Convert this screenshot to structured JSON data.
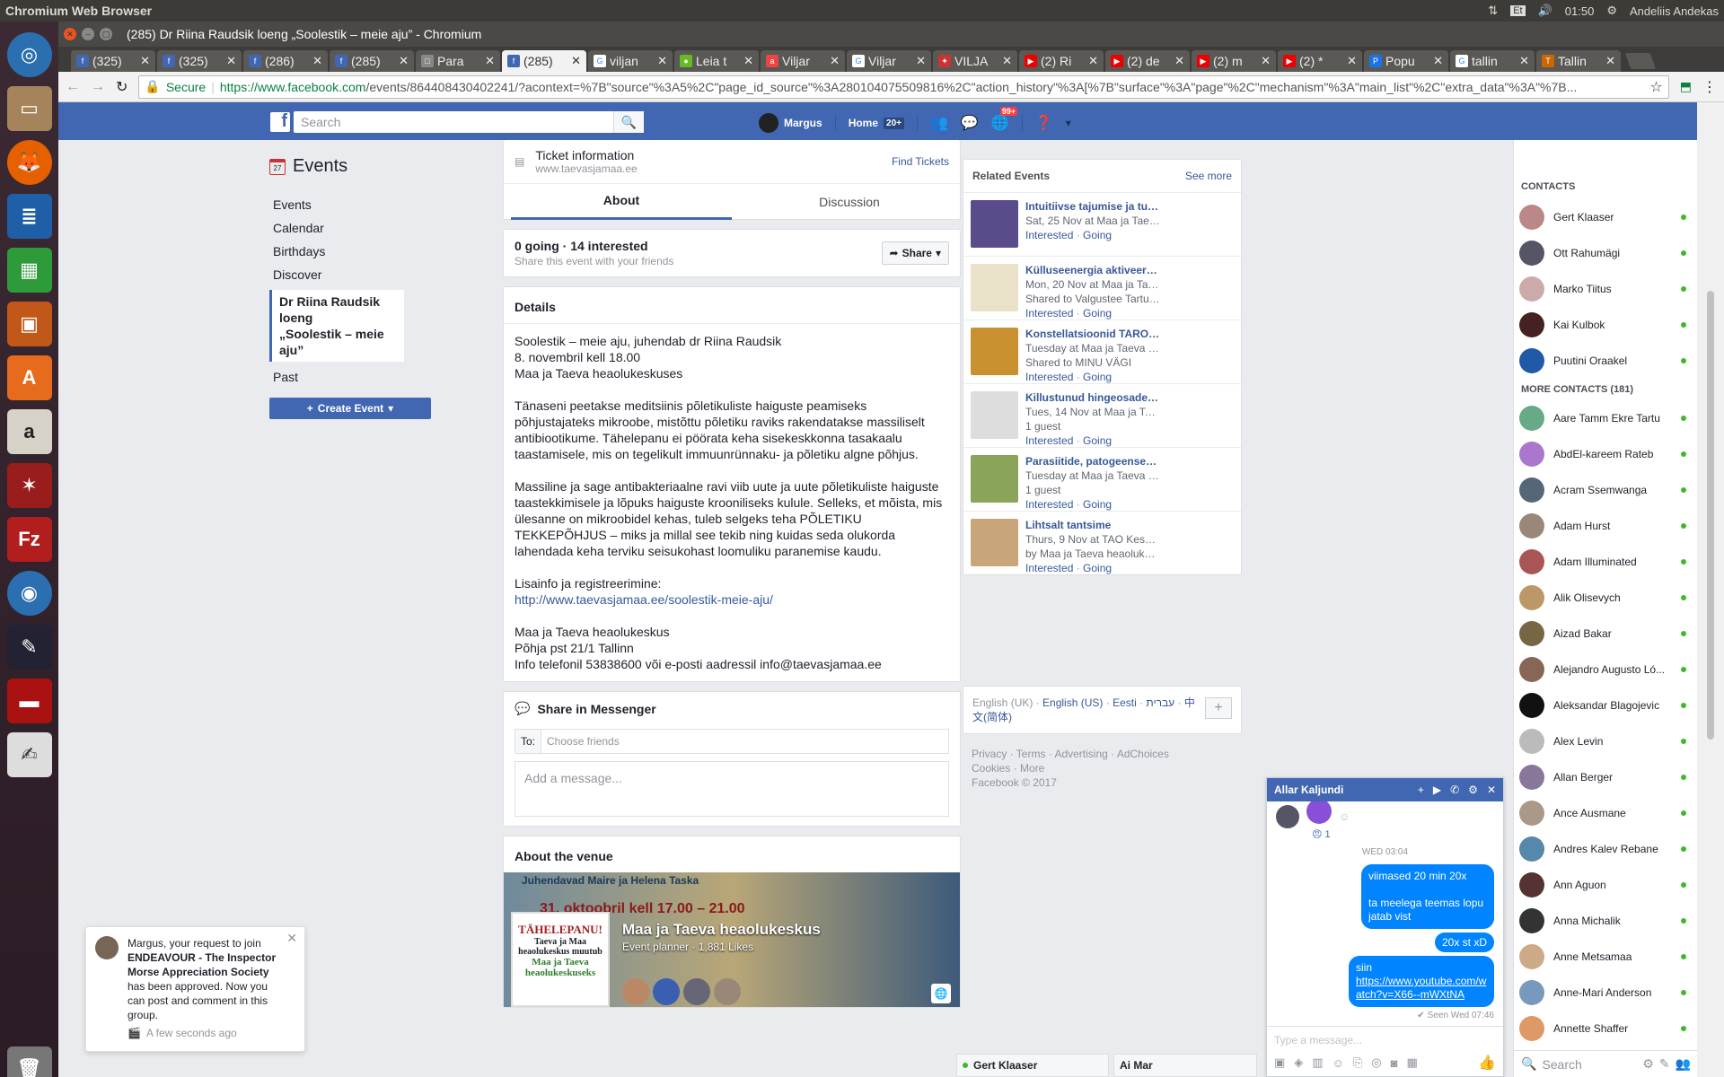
{
  "os": {
    "app_title": "Chromium Web Browser",
    "time": "01:50",
    "user": "Andeliis Andekas",
    "lang": "Et"
  },
  "browser": {
    "window_title": "(285) Dr Riina Raudsik loeng „Soolestik – meie aju” - Chromium",
    "tabs": [
      {
        "label": "(325)",
        "fav": "f",
        "color": "#4267b2"
      },
      {
        "label": "(325)",
        "fav": "f",
        "color": "#4267b2"
      },
      {
        "label": "(286)",
        "fav": "f",
        "color": "#4267b2"
      },
      {
        "label": "(285)",
        "fav": "f",
        "color": "#4267b2"
      },
      {
        "label": "Para",
        "fav": "□",
        "color": "#888"
      },
      {
        "label": "(285)",
        "fav": "f",
        "color": "#4267b2",
        "active": true
      },
      {
        "label": "viljan",
        "fav": "G",
        "color": "#fff"
      },
      {
        "label": "Leia t",
        "fav": "●",
        "color": "#6b2"
      },
      {
        "label": "Viljar",
        "fav": "a",
        "color": "#e44"
      },
      {
        "label": "Viljar",
        "fav": "G",
        "color": "#fff"
      },
      {
        "label": "VILJA",
        "fav": "✦",
        "color": "#c33"
      },
      {
        "label": "(2) Ri",
        "fav": "▶",
        "color": "#e00"
      },
      {
        "label": "(2) de",
        "fav": "▶",
        "color": "#e00"
      },
      {
        "label": "(2) m",
        "fav": "▶",
        "color": "#e00"
      },
      {
        "label": "(2) *",
        "fav": "▶",
        "color": "#e00"
      },
      {
        "label": "Popu",
        "fav": "P",
        "color": "#1a73e8"
      },
      {
        "label": "tallin",
        "fav": "G",
        "color": "#fff"
      },
      {
        "label": "Tallin",
        "fav": "T",
        "color": "#c60"
      }
    ],
    "secure_label": "Secure",
    "url_host": "https://www.facebook.com",
    "url_rest": "/events/864408430402241/?acontext=%7B\"source\"%3A5%2C\"page_id_source\"%3A280104075509816%2C\"action_history\"%3A[%7B\"surface\"%3A\"page\"%2C\"mechanism\"%3A\"main_list\"%2C\"extra_data\"%3A\"%7B..."
  },
  "fb": {
    "search_placeholder": "Search",
    "user": "Margus",
    "home": "Home",
    "home_badge": "20+",
    "notif_badge": "99+"
  },
  "left_nav": {
    "header": "Events",
    "items": [
      "Events",
      "Calendar",
      "Birthdays",
      "Discover"
    ],
    "active_line1": "Dr Riina Raudsik loeng",
    "active_line2": "„Soolestik – meie aju”",
    "past": "Past",
    "create": "Create Event"
  },
  "event": {
    "ticket_title": "Ticket information",
    "ticket_url": "www.taevasjamaa.ee",
    "find_tickets": "Find Tickets",
    "tab_about": "About",
    "tab_discussion": "Discussion",
    "going": "0 going · 14 interested",
    "share_sub": "Share this event with your friends",
    "share_btn": "Share",
    "details_h": "Details",
    "d1": "Soolestik – meie aju, juhendab dr Riina Raudsik",
    "d2": "8. novembril kell 18.00",
    "d3": "Maa ja Taeva heaolukeskuses",
    "p1": "Tänaseni peetakse meditsiinis põletikuliste haiguste peamiseks põhjustajateks mikroobe, mistõttu põletiku raviks rakendatakse massiliselt antibiootikume. Tähelepanu ei pöörata keha sisekeskkonna tasakaalu taastamisele, mis on tegelikult immuunrünnaku- ja põletiku algne põhjus.",
    "p2": "Massiline ja sage antibakteriaalne ravi viib uute ja uute põletikuliste haiguste taastekkimisele ja lõpuks haiguste krooniliseks kulule. Selleks, et mõista, mis ülesanne on mikroobidel kehas, tuleb selgeks teha PÕLETIKU TEKKEPÕHJUS – miks ja millal see tekib ning kuidas seda olukorda lahendada keha terviku seisukohast loomuliku paranemise kaudu.",
    "info_label": "Lisainfo ja registreerimine:",
    "info_link": "http://www.taevasjamaa.ee/soolestik-meie-aju/",
    "a1": "Maa ja Taeva heaolukeskus",
    "a2": "Põhja pst 21/1 Tallinn",
    "a3": "Info telefonil 53838600 või e-posti aadressil info@taevasjamaa.ee",
    "messenger_h": "Share in Messenger",
    "to_label": "To:",
    "to_placeholder": "Choose friends",
    "msg_placeholder": "Add a message...",
    "venue_h": "About the venue",
    "venue_name": "Maa ja Taeva heaolukeskus",
    "venue_sub": "Event planner · 1,881 Likes",
    "venue_banner_line1": "Juhendavad Maire ja Helena Taska",
    "venue_banner_line2": "31. oktoobril kell 17.00 – 21.00",
    "venue_logo_line1": "TÄHELEPANU!",
    "venue_logo_line2": "Taeva ja Maa heaolukeskus muutub",
    "venue_logo_line3": "Maa ja Taeva heaolukeskuseks"
  },
  "related": {
    "header": "Related Events",
    "see_more": "See more",
    "items": [
      {
        "title": "Intuitiivse tajumise ja tunneta...",
        "l2": "Sat, 25 Nov at Maa ja Taeva he...",
        "l3": "",
        "color": "#5a4b8a"
      },
      {
        "title": "Külluseenergia aktiveerimine ...",
        "l2": "Mon, 20 Nov at Maa ja Taeva h...",
        "l3": "Shared to Valgustee Tartus (spir...",
        "color": "#e9e2c8"
      },
      {
        "title": "Konstellatsioonid TARO kaart...",
        "l2": "Tuesday at Maa ja Taeva heaol...",
        "l3": "Shared to MINU VÄGI",
        "color": "#c8902f"
      },
      {
        "title": "Killustunud hingeosade tagas...",
        "l2": "Tues, 14 Nov at Maa ja Taeva h...",
        "l3": "1 guest",
        "color": "#ddd"
      },
      {
        "title": "Parasiitide, patogeensete bak...",
        "l2": "Tuesday at Maa ja Taeva heaol...",
        "l3": "1 guest",
        "color": "#8aa55a"
      },
      {
        "title": "Lihtsalt tantsime",
        "l2": "Thurs, 9 Nov at TAO Keskus",
        "l3": "by Maa ja Taeva heaolukeskus",
        "color": "#c8a67a"
      }
    ],
    "interested": "Interested",
    "going": "Going"
  },
  "footer": {
    "langs": [
      "English (UK)",
      "English (US)",
      "Eesti",
      "עברית",
      "中文(简体)"
    ],
    "links1": "Privacy · Terms · Advertising · AdChoices",
    "links2": "Cookies · More",
    "copyright": "Facebook © 2017"
  },
  "contacts": {
    "header": "CONTACTS",
    "more_header": "MORE CONTACTS (181)",
    "top": [
      {
        "name": "Gert Klaaser",
        "color": "#b88"
      },
      {
        "name": "Ott Rahumägi",
        "color": "#556"
      },
      {
        "name": "Marko Tiitus",
        "color": "#caa"
      },
      {
        "name": "Kai Kulbok",
        "color": "#422"
      },
      {
        "name": "Puutini Oraakel",
        "color": "#1e5aa8"
      }
    ],
    "more": [
      {
        "name": "Aare Tamm Ekre Tartu",
        "color": "#6a8"
      },
      {
        "name": "AbdEl-kareem Rateb",
        "color": "#a7c"
      },
      {
        "name": "Acram Ssemwanga",
        "color": "#567"
      },
      {
        "name": "Adam Hurst",
        "color": "#987"
      },
      {
        "name": "Adam Illuminated",
        "color": "#a55"
      },
      {
        "name": "Alik Olisevych",
        "color": "#b96"
      },
      {
        "name": "Aizad Bakar",
        "color": "#764"
      },
      {
        "name": "Alejandro Augusto Ló...",
        "color": "#865"
      },
      {
        "name": "Aleksandar Blagojevic",
        "color": "#111"
      },
      {
        "name": "Alex Levin",
        "color": "#bbb"
      },
      {
        "name": "Allan Berger",
        "color": "#879"
      },
      {
        "name": "Ance Ausmane",
        "color": "#a98"
      },
      {
        "name": "Andres Kalev Rebane",
        "color": "#58a"
      },
      {
        "name": "Ann Aguon",
        "color": "#533"
      },
      {
        "name": "Anna Michalik",
        "color": "#333"
      },
      {
        "name": "Anne Metsamaa",
        "color": "#ca8"
      },
      {
        "name": "Anne-Mari Anderson",
        "color": "#79b"
      },
      {
        "name": "Annette Shaffer",
        "color": "#d96"
      }
    ],
    "search_placeholder": "Search"
  },
  "chat": {
    "name": "Allar Kaljundi",
    "reaction_count": "1",
    "date": "WED 03:04",
    "m1a": "viimased 20 min 20x",
    "m1b": "ta meelega teemas lopu jatab vist",
    "m2": "20x st xD",
    "m3a": "siin",
    "m3b": "https://www.youtube.com/watch?v=X66--mWXtNA",
    "seen": "Seen Wed 07:46",
    "placeholder": "Type a message..."
  },
  "bottom_chats": [
    "Gert Klaaser",
    "Ai Mar"
  ],
  "notification": {
    "pre": "Margus, your request to join ",
    "group": "ENDEAVOUR - The Inspector Morse Appreciation Society",
    "post": " has been approved. Now you can post and comment in this group.",
    "time": "A few seconds ago"
  }
}
